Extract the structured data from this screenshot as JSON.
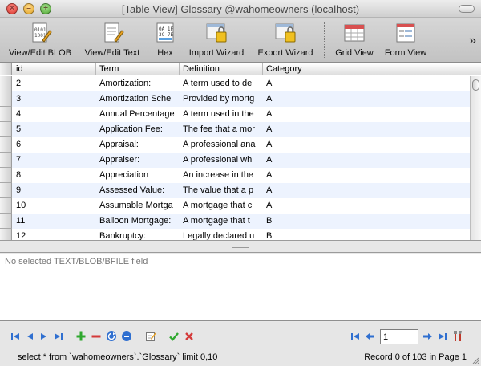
{
  "window": {
    "title": "[Table View] Glossary @wahomeowners (localhost)"
  },
  "toolbar": {
    "items": [
      {
        "label": "View/Edit BLOB",
        "icon": "view-edit-blob-icon"
      },
      {
        "label": "View/Edit Text",
        "icon": "view-edit-text-icon"
      },
      {
        "label": "Hex",
        "icon": "hex-icon"
      },
      {
        "label": "Import Wizard",
        "icon": "import-wizard-icon"
      },
      {
        "label": "Export Wizard",
        "icon": "export-wizard-icon"
      },
      {
        "label": "Grid View",
        "icon": "grid-view-icon"
      },
      {
        "label": "Form View",
        "icon": "form-view-icon"
      }
    ],
    "overflow": "»"
  },
  "table": {
    "columns": [
      "id",
      "Term",
      "Definition",
      "Category"
    ],
    "rows": [
      [
        "2",
        "Amortization:",
        "A term used to de",
        "A"
      ],
      [
        "3",
        "Amortization Sche",
        "Provided by mortg",
        "A"
      ],
      [
        "4",
        "Annual Percentage",
        "A term used in the",
        "A"
      ],
      [
        "5",
        "Application Fee:",
        "The fee that a mor",
        "A"
      ],
      [
        "6",
        "Appraisal:",
        "A professional ana",
        "A"
      ],
      [
        "7",
        "Appraiser:",
        "A professional wh",
        "A"
      ],
      [
        "8",
        "Appreciation",
        "An increase in the",
        "A"
      ],
      [
        "9",
        "Assessed Value:",
        "The value that a p",
        "A"
      ],
      [
        "10",
        "Assumable Mortga",
        "A mortgage that c",
        "A"
      ],
      [
        "11",
        "Balloon Mortgage:",
        "A mortgage that t",
        "B"
      ],
      [
        "12",
        "Bankruptcy:",
        "Legally declared u",
        "B"
      ]
    ]
  },
  "blob": {
    "message": "No selected TEXT/BLOB/BFILE field"
  },
  "footer": {
    "query": "select * from `wahomeowners`.`Glossary` limit 0,10",
    "page_value": "1",
    "record_status": "Record 0 of 103 in Page 1"
  },
  "colors": {
    "accent": "#2f6fd0",
    "add": "#2fa82f",
    "remove": "#d43a3a",
    "row_alt": "#edf3fe"
  }
}
